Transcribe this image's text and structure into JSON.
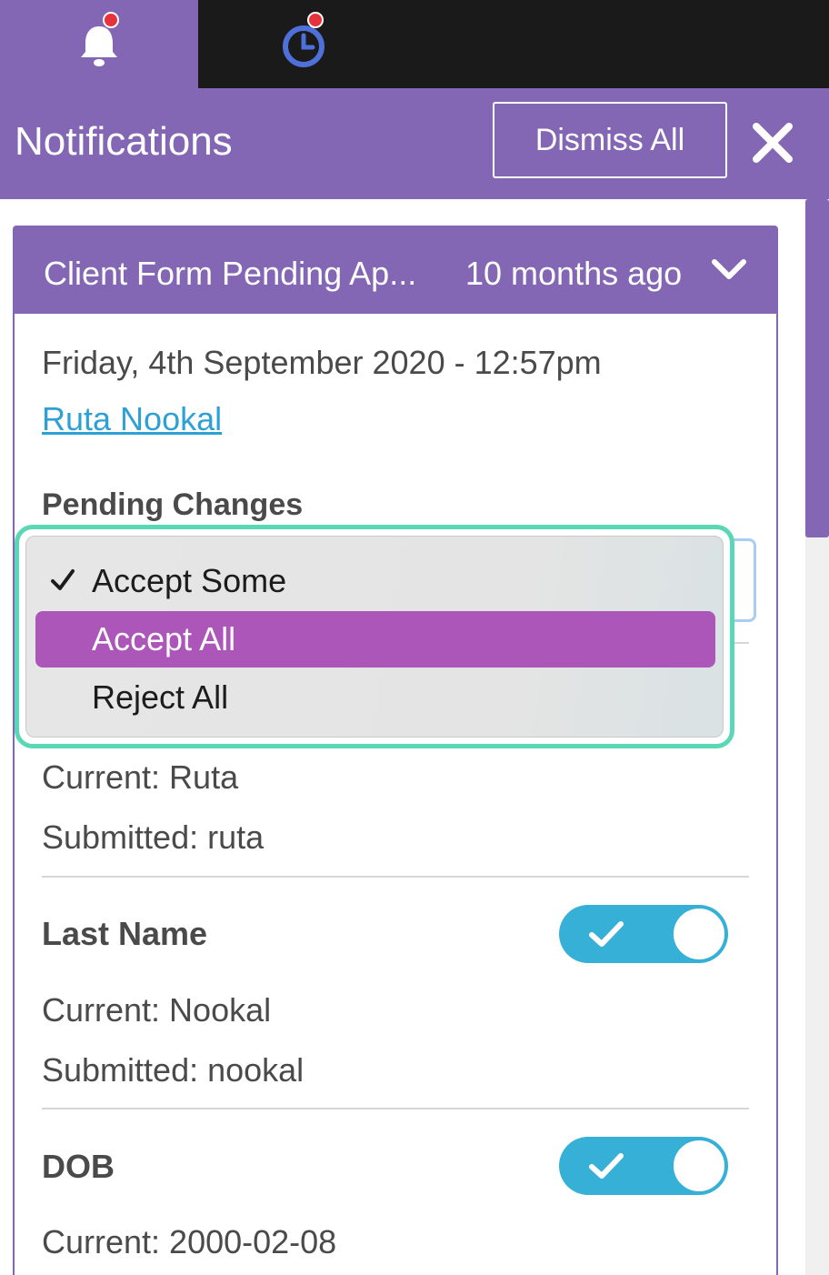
{
  "tabs": [
    {
      "name": "notifications",
      "icon": "bell-icon",
      "has_badge": true
    },
    {
      "name": "reminders",
      "icon": "clock-icon",
      "has_badge": true
    }
  ],
  "header": {
    "title": "Notifications",
    "dismiss_label": "Dismiss All",
    "close_icon": "close-icon"
  },
  "notification": {
    "title": "Client Form Pending Ap...",
    "time_ago": "10 months ago",
    "date": "Friday, 4th September 2020 - 12:57pm",
    "client_name": "Ruta Nookal",
    "pending_label": "Pending Changes"
  },
  "dropdown": {
    "options": [
      "Accept Some",
      "Accept All",
      "Reject All"
    ],
    "checked": "Accept Some",
    "highlighted": "Accept All"
  },
  "fields": {
    "first_name": {
      "current": "Current: Ruta",
      "submitted": "Submitted: ruta"
    },
    "last_name": {
      "label": "Last Name",
      "current": "Current: Nookal",
      "submitted": "Submitted: nookal",
      "accepted": true
    },
    "dob": {
      "label": "DOB",
      "current": "Current: 2000-02-08",
      "accepted": true
    }
  },
  "colors": {
    "brand_purple": "#8467b4",
    "toggle_blue": "#36b0d6",
    "highlight_magenta": "#ab56b8",
    "focus_teal": "#5ad7b4",
    "link_blue": "#2ea1d4",
    "badge_red": "#e5323b"
  }
}
